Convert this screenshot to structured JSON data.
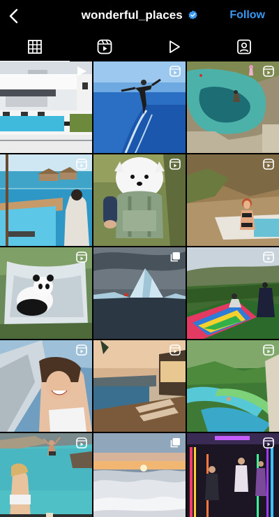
{
  "header": {
    "back_icon": "chevron-left-icon",
    "username": "wonderful_places",
    "verified_icon": "verified-badge-icon",
    "follow_label": "Follow",
    "follow_color": "#3897f0"
  },
  "tabs": [
    {
      "icon": "grid-icon",
      "active": true
    },
    {
      "icon": "reels-icon",
      "active": false
    },
    {
      "icon": "play-icon",
      "active": false
    },
    {
      "icon": "tagged-icon",
      "active": false
    }
  ],
  "posts": [
    {
      "badge": "play-icon",
      "scene": "white villa with pool and sun loungers"
    },
    {
      "badge": "reels-icon",
      "scene": "person jumping above ocean coastline"
    },
    {
      "badge": "reels-icon",
      "scene": "people jumping into natural blue pool"
    },
    {
      "badge": "reels-icon",
      "scene": "woman at overwater infinity pool"
    },
    {
      "badge": "reels-icon",
      "scene": "white samoyed dog in carrier backpack"
    },
    {
      "badge": "reels-icon",
      "scene": "woman at cliff edge pool"
    },
    {
      "badge": "reels-icon",
      "scene": "panda in snowy waterfall"
    },
    {
      "badge": "carousel-icon",
      "scene": "iceberg in dark sea"
    },
    {
      "badge": "reels-icon",
      "scene": "colorful slide on hilltop"
    },
    {
      "badge": "reels-icon",
      "scene": "woman selfie on cliff structure"
    },
    {
      "badge": "reels-icon",
      "scene": "infinity pool terrace at sunset"
    },
    {
      "badge": "reels-icon",
      "scene": "green water slide in jungle"
    },
    {
      "badge": "reels-icon",
      "scene": "person jumping into turquoise lagoon"
    },
    {
      "badge": "carousel-icon",
      "scene": "sunset above sea of clouds"
    },
    {
      "badge": "reels-icon",
      "scene": "neon lit tunnel with visitors"
    }
  ]
}
